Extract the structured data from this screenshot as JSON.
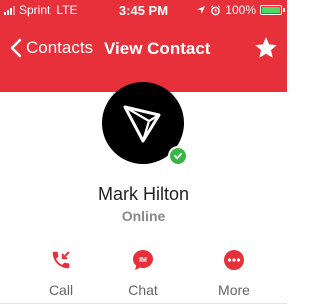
{
  "status_bar": {
    "carrier": "Sprint",
    "network": "LTE",
    "time": "3:45 PM",
    "battery": "100%",
    "icons": [
      "signal-icon",
      "location-arrow-icon",
      "alarm-icon",
      "battery-icon"
    ]
  },
  "nav": {
    "back_label": "Contacts",
    "title": "View Contact",
    "favorite_icon": "star-icon"
  },
  "contact": {
    "name": "Mark Hilton",
    "status": "Online",
    "presence_color": "#39b54a"
  },
  "actions": [
    {
      "label": "Call",
      "icon": "phone-callback-icon"
    },
    {
      "label": "Chat",
      "icon": "chat-bubble-icon"
    },
    {
      "label": "More",
      "icon": "more-dots-icon"
    }
  ],
  "colors": {
    "accent": "#e8303a",
    "online": "#39b54a"
  }
}
